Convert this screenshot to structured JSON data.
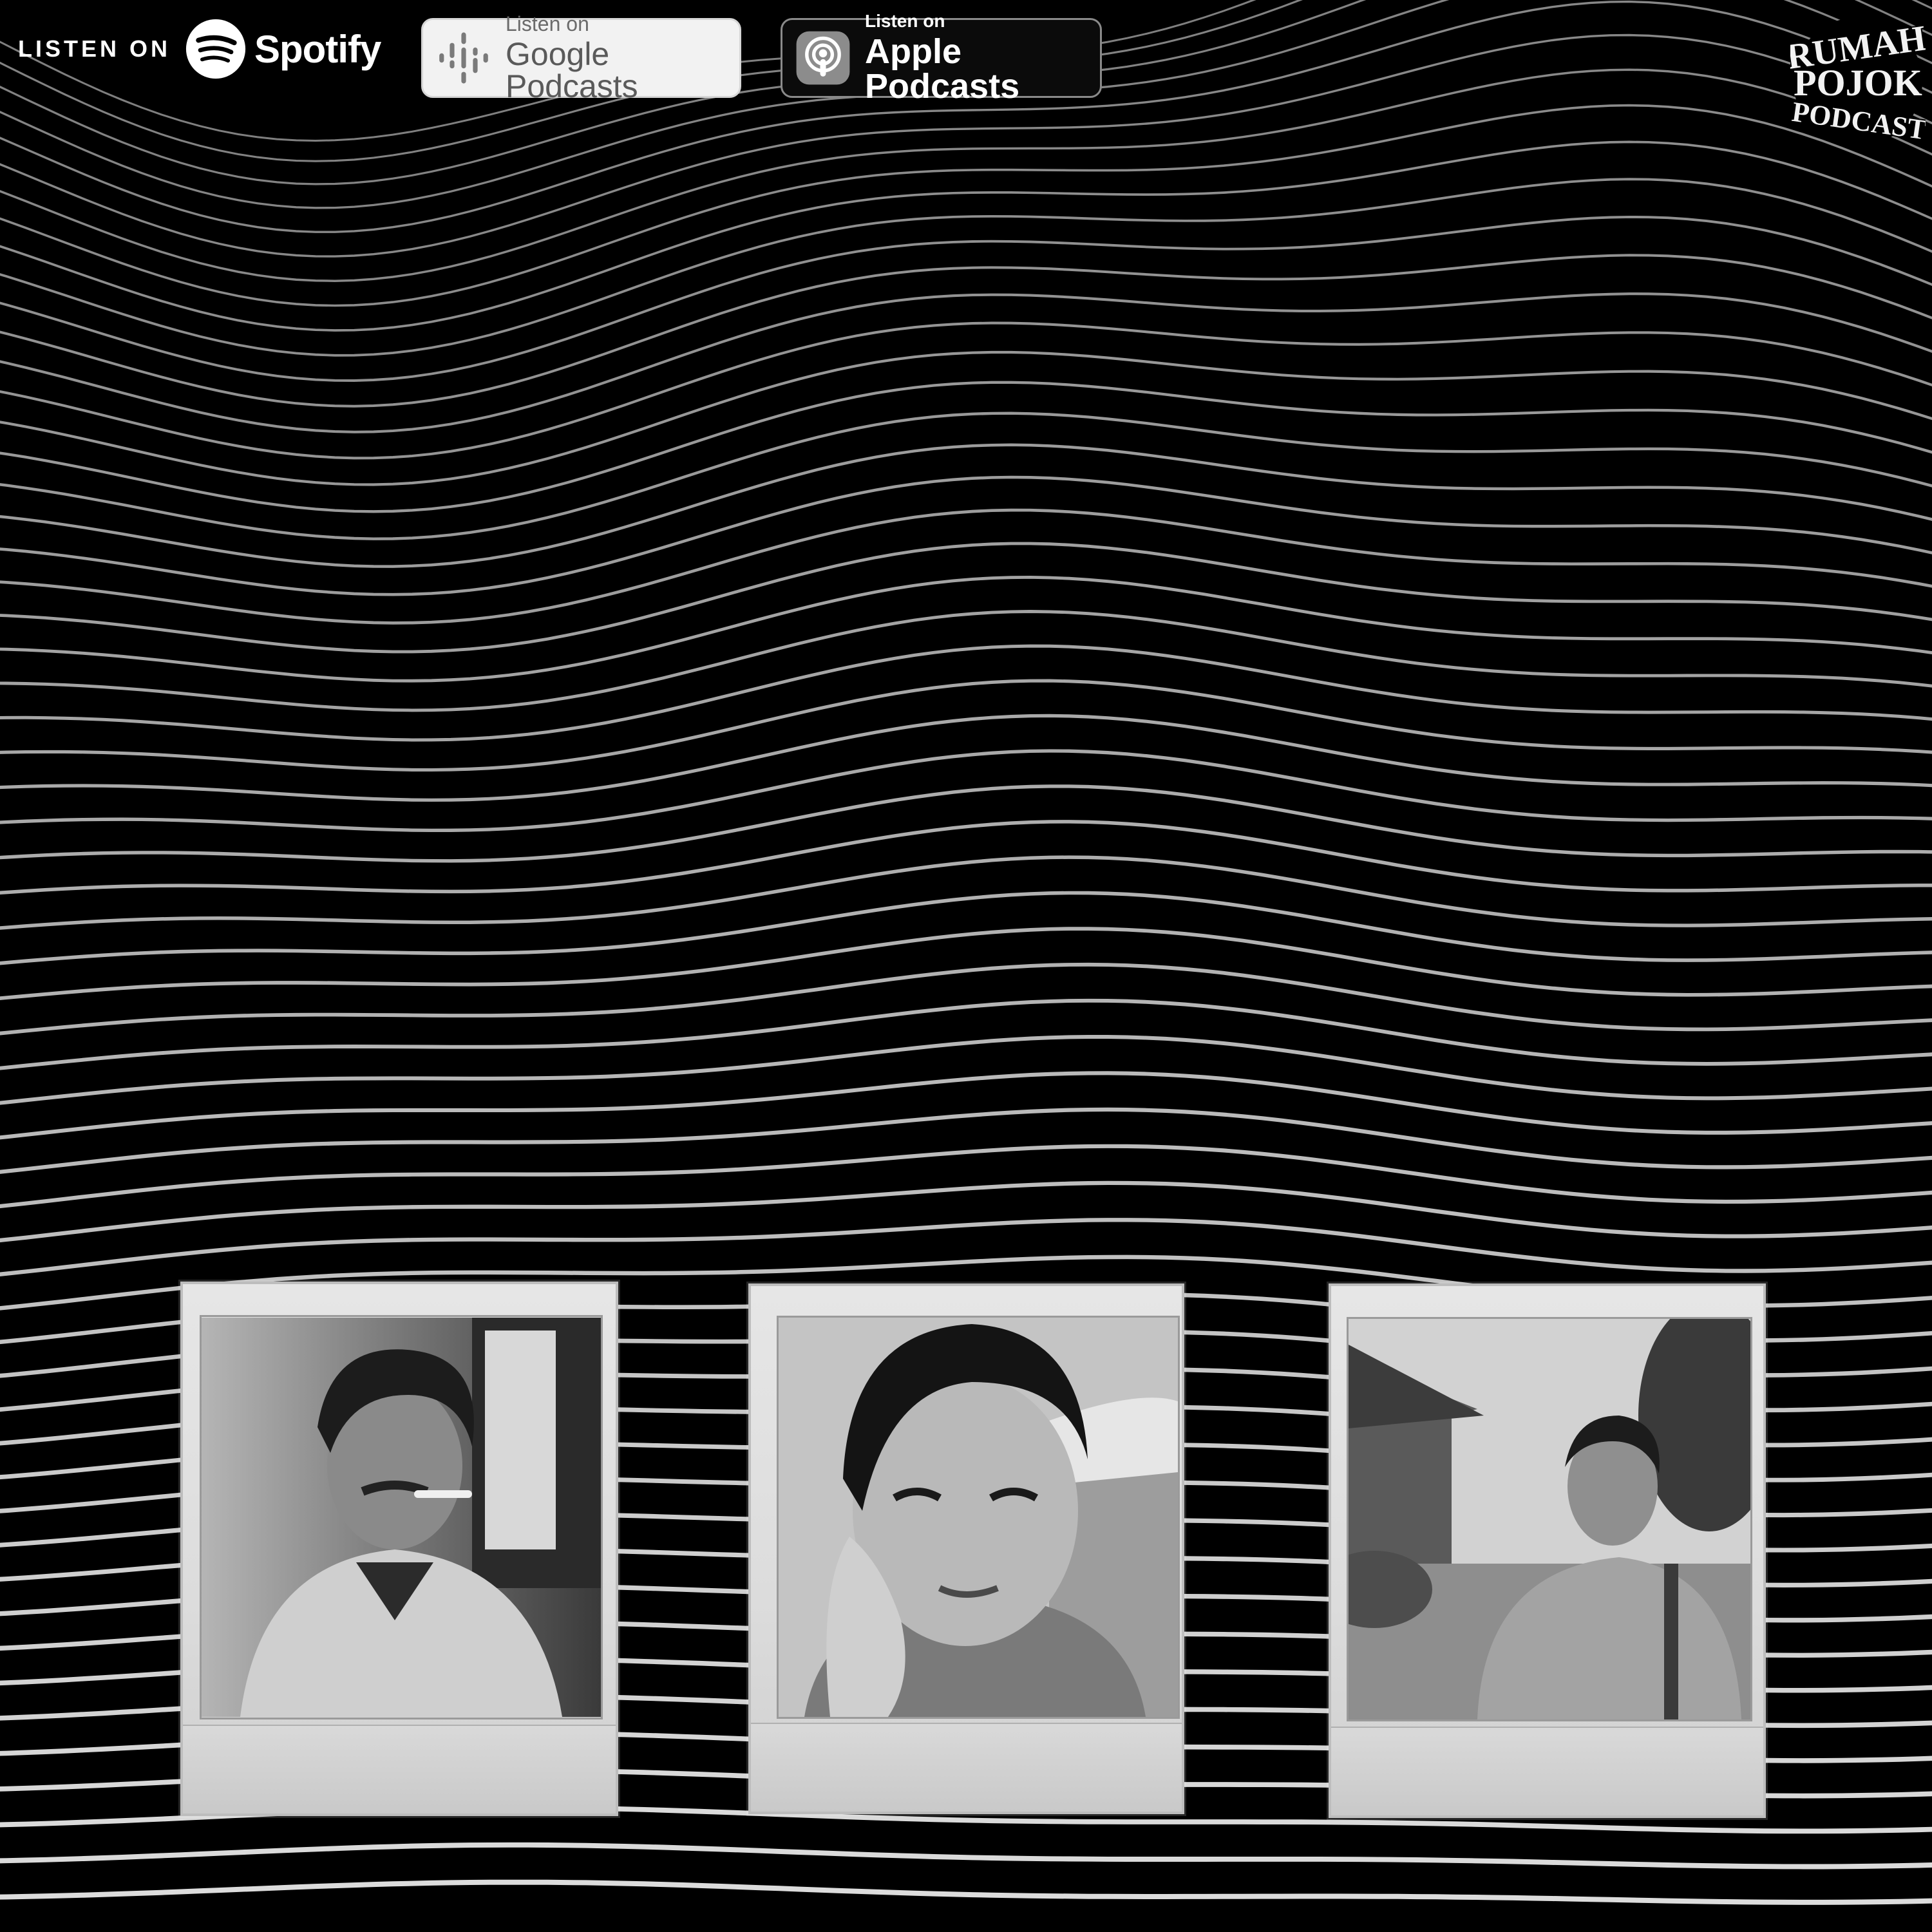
{
  "badges": {
    "spotify": {
      "listen_label": "LISTEN ON",
      "brand": "Spotify",
      "icon": "spotify-icon"
    },
    "google": {
      "small": "Listen on",
      "big": "Google Podcasts",
      "icon": "google-podcasts-icon"
    },
    "apple": {
      "small": "Listen on",
      "big": "Apple Podcasts",
      "icon": "apple-podcasts-icon"
    }
  },
  "logo": {
    "line1": "RUMAH",
    "line2": "POJOK",
    "line3": "PODCAST"
  },
  "hosts": [
    {
      "photo": "man-with-mustache-and-cigarette"
    },
    {
      "photo": "woman-hand-on-cheek"
    },
    {
      "photo": "man-in-plaid-shirt-outdoors"
    }
  ],
  "colors": {
    "background": "#000000",
    "lines": "#e8e8e8",
    "polaroid": "#dedede"
  }
}
